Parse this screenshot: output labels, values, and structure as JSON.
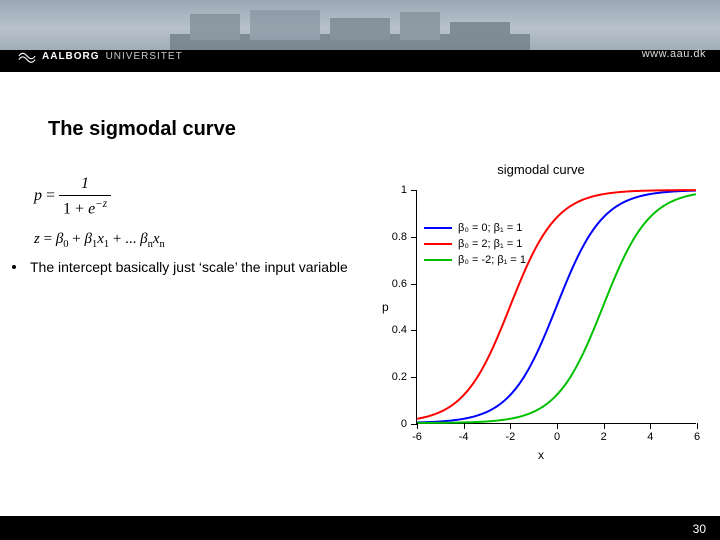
{
  "header": {
    "logo_bold": "AALBORG",
    "logo_light": "UNIVERSITET",
    "site_url": "www.aau.dk"
  },
  "title": "The sigmodal curve",
  "bullet": "The intercept basically just ‘scale’ the input variable",
  "formula": {
    "lhs1": "p",
    "eq": " = ",
    "num": "1",
    "den_prefix": "1 + e",
    "den_exp": "−z",
    "z_line": "z = β₀ + β₁x₁ + ... βₙxₙ"
  },
  "chart_data": {
    "type": "line",
    "title": "sigmodal curve",
    "xlabel": "x",
    "ylabel": "p",
    "xlim": [
      -6,
      6
    ],
    "ylim": [
      0,
      1
    ],
    "xticks": [
      -6,
      -4,
      -2,
      0,
      2,
      4,
      6
    ],
    "yticks": [
      0,
      0.2,
      0.4,
      0.6,
      0.8,
      1
    ],
    "x": [
      -6,
      -5,
      -4,
      -3,
      -2,
      -1,
      0,
      1,
      2,
      3,
      4,
      5,
      6
    ],
    "series": [
      {
        "name": "β₀ = 0; β₁ = 1",
        "color": "#0000ff",
        "beta0": 0,
        "values": [
          0.0025,
          0.0067,
          0.018,
          0.0474,
          0.1192,
          0.2689,
          0.5,
          0.7311,
          0.8808,
          0.9526,
          0.982,
          0.9933,
          0.9975
        ]
      },
      {
        "name": "β₀ = 2; β₁ = 1",
        "color": "#ff0000",
        "beta0": 2,
        "values": [
          0.018,
          0.0474,
          0.1192,
          0.2689,
          0.5,
          0.7311,
          0.8808,
          0.9526,
          0.982,
          0.9933,
          0.9975,
          0.9991,
          0.9997
        ]
      },
      {
        "name": "β₀ = -2; β₁ = 1",
        "color": "#00c000",
        "beta0": -2,
        "values": [
          0.0003,
          0.0009,
          0.0025,
          0.0067,
          0.018,
          0.0474,
          0.1192,
          0.2689,
          0.5,
          0.7311,
          0.8808,
          0.9526,
          0.982
        ]
      }
    ]
  },
  "page_number": "30"
}
